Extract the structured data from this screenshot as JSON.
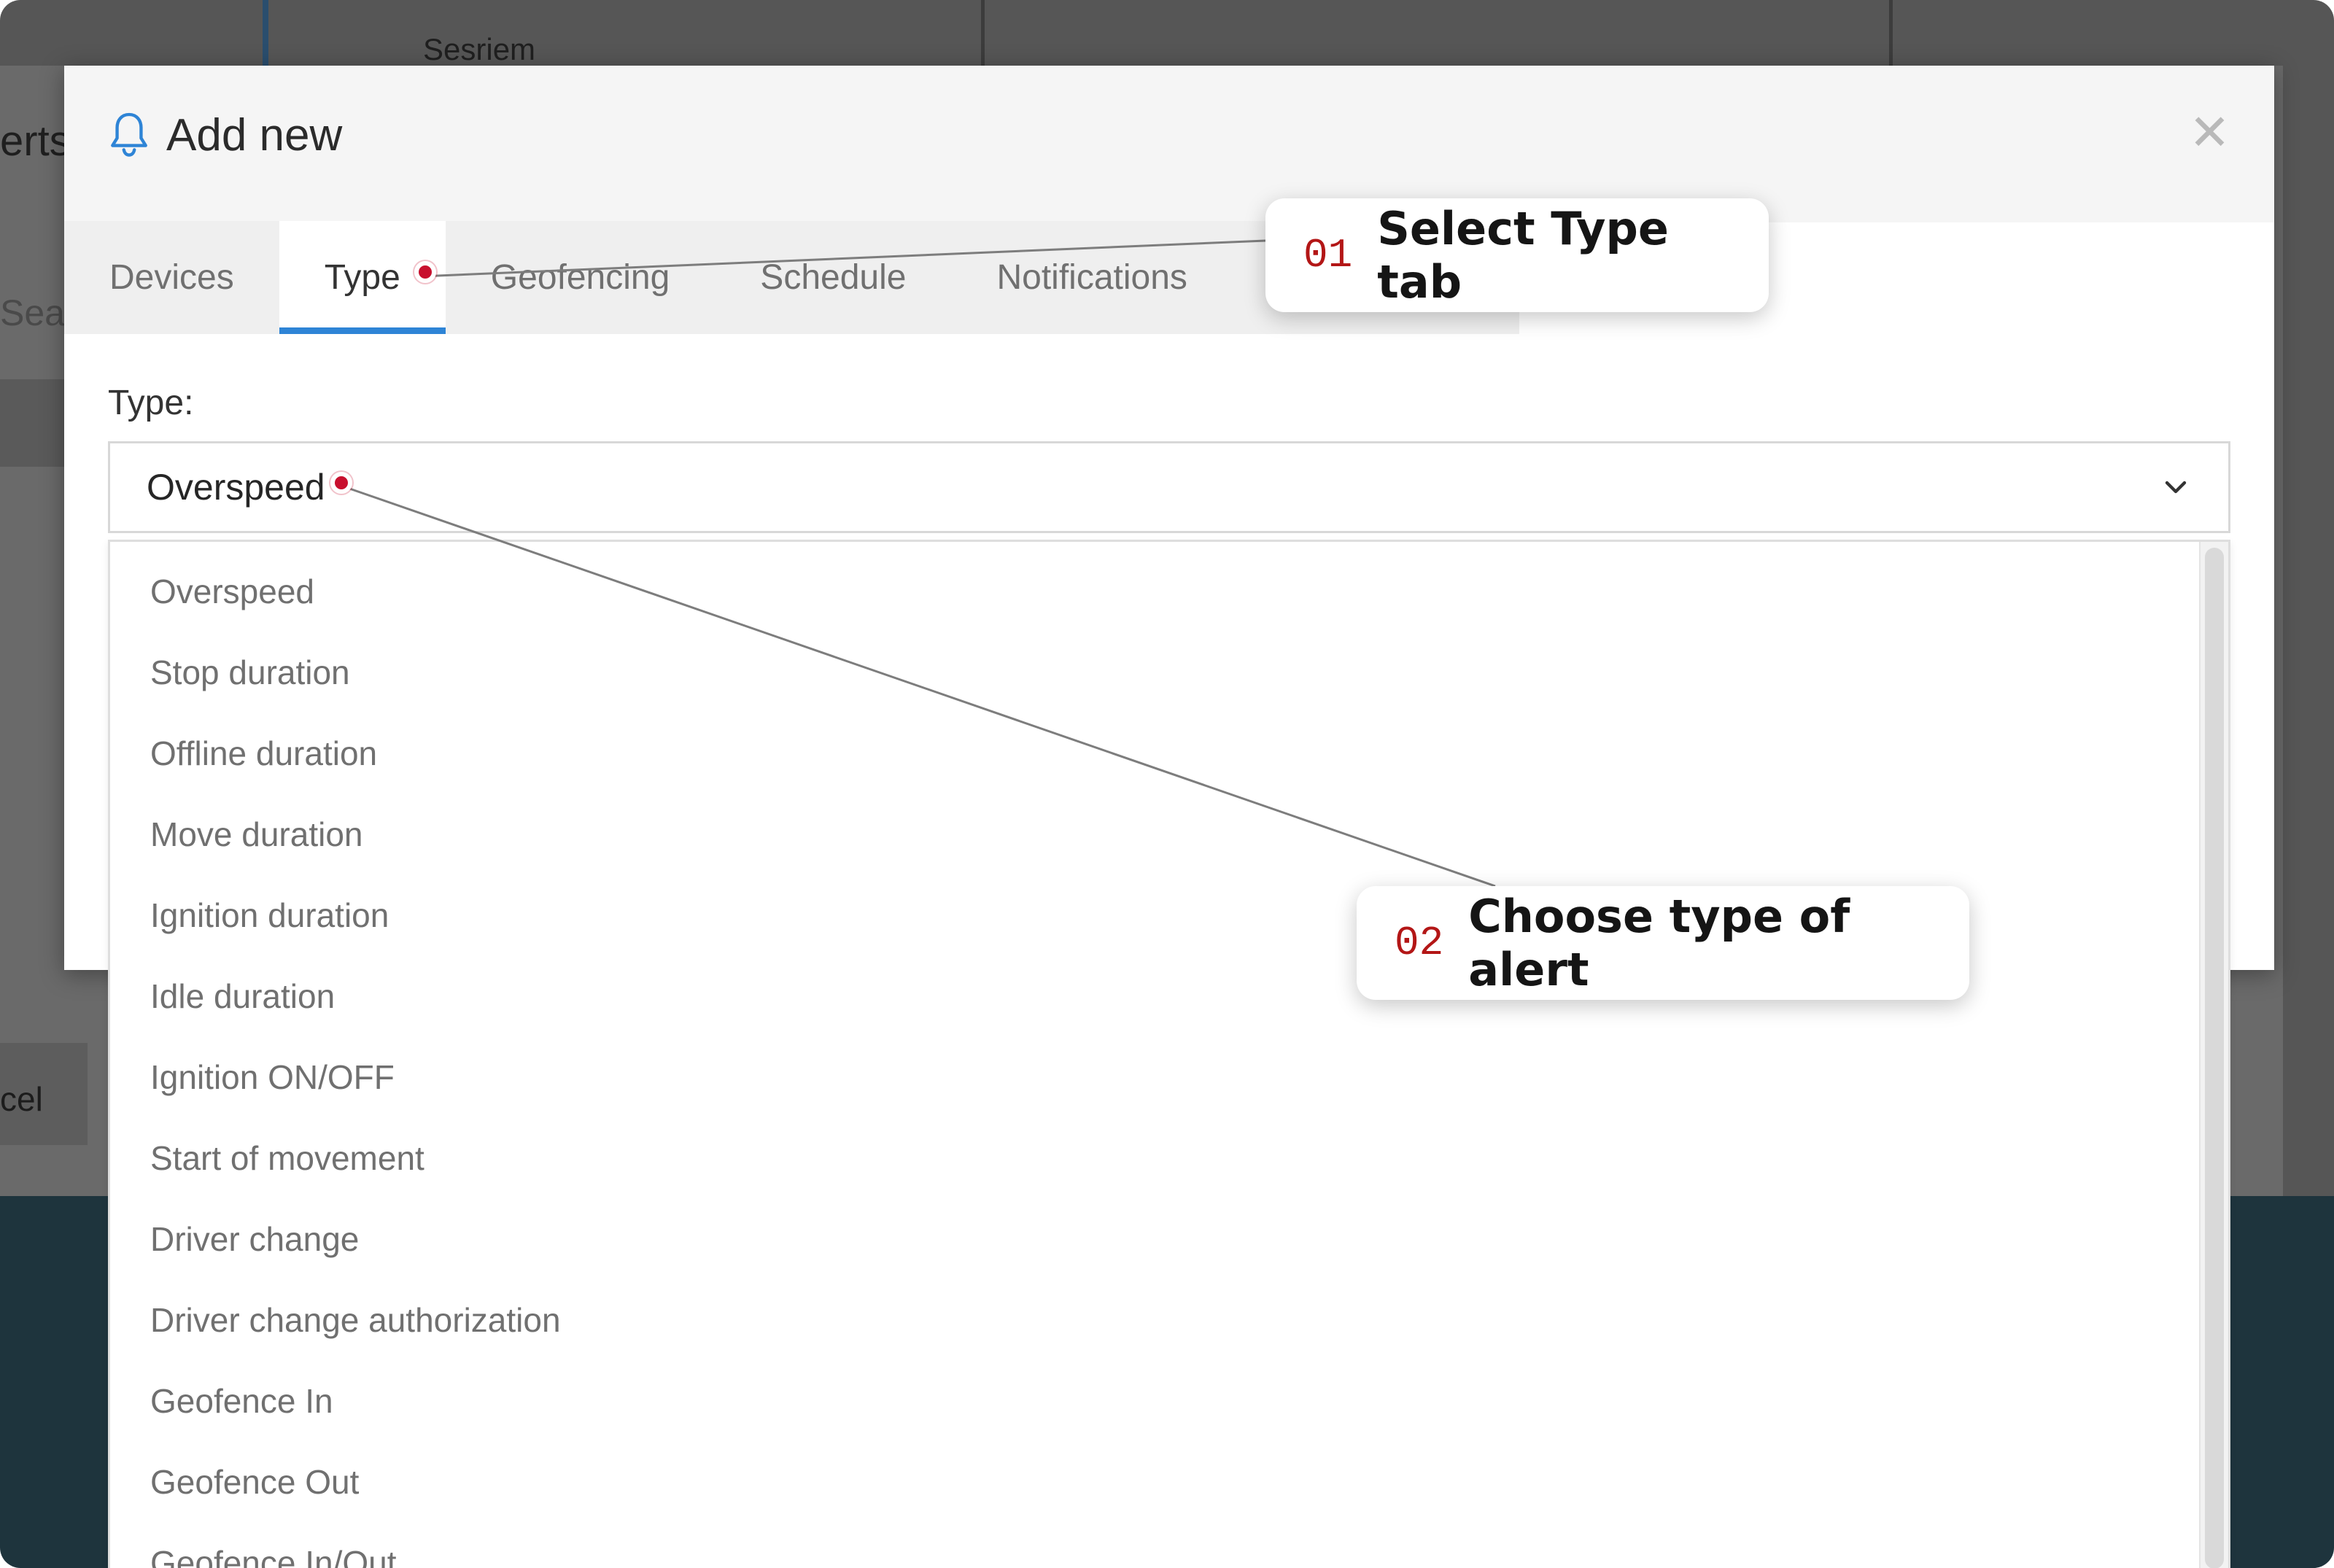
{
  "background": {
    "map_label": "Sesriem",
    "page_title_fragment": "erts",
    "search_placeholder_fragment": "Sear",
    "cancel_fragment": "cel"
  },
  "modal": {
    "title": "Add new",
    "title_icon": "bell-icon",
    "close_icon": "close-icon",
    "tabs": [
      {
        "label": "Devices",
        "active": false
      },
      {
        "label": "Type",
        "active": true
      },
      {
        "label": "Geofencing",
        "active": false
      },
      {
        "label": "Schedule",
        "active": false
      },
      {
        "label": "Notifications",
        "active": false
      }
    ],
    "type_field": {
      "label": "Type:",
      "selected": "Overspeed",
      "chevron_icon": "chevron-down-icon"
    },
    "type_options": [
      "Overspeed",
      "Stop duration",
      "Offline duration",
      "Move duration",
      "Ignition duration",
      "Idle duration",
      "Ignition ON/OFF",
      "Start of movement",
      "Driver change",
      "Driver change authorization",
      "Geofence In",
      "Geofence Out",
      "Geofence In/Out"
    ]
  },
  "callouts": [
    {
      "number": "01",
      "text": "Select Type tab"
    },
    {
      "number": "02",
      "text": "Choose type of alert"
    }
  ],
  "colors": {
    "accent": "#2e84d6",
    "callout_number": "#b31616",
    "marker": "#c8102e"
  }
}
